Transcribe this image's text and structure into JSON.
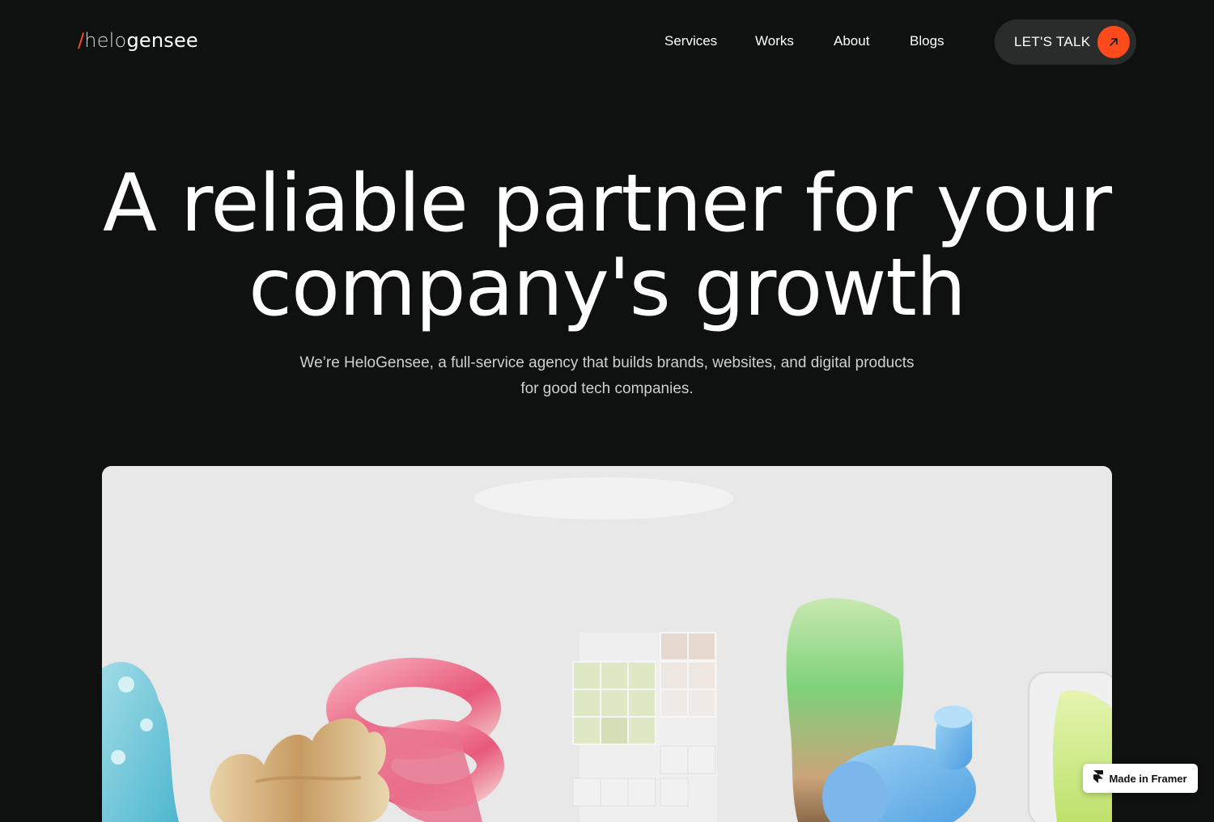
{
  "brand": {
    "slash": "/",
    "part1": "helo",
    "part2": "gensee"
  },
  "nav": {
    "items": [
      {
        "label": "Services"
      },
      {
        "label": "Works"
      },
      {
        "label": "About"
      },
      {
        "label": "Blogs"
      }
    ],
    "cta_label": "LET'S TALK",
    "cta_icon": "arrow-up-right-icon"
  },
  "hero": {
    "title_line1": "A reliable partner for your",
    "title_line2": "company's growth",
    "subtitle_line1": "We’re HeloGensee, a full-service agency that builds brands, websites, and digital products",
    "subtitle_line2": "for good tech companies."
  },
  "badge": {
    "label": "Made in Framer",
    "icon": "framer-icon"
  },
  "colors": {
    "accent": "#ff4a1c",
    "background": "#0f1110",
    "cta_bg": "#2a2c2c"
  }
}
